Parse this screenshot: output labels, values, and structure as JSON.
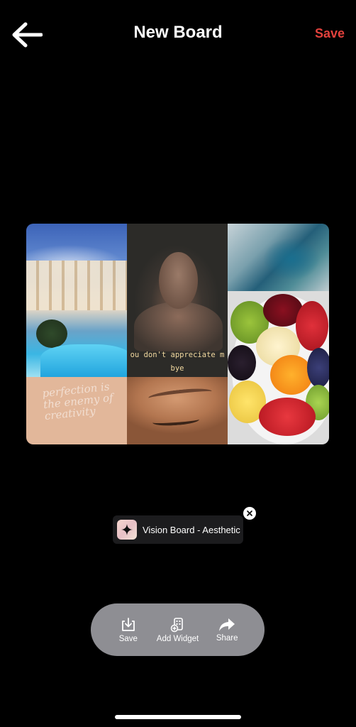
{
  "header": {
    "back_icon": "arrow-left-icon",
    "title": "New Board",
    "save_label": "Save"
  },
  "board": {
    "tiles": [
      {
        "name": "luxury-house-photo"
      },
      {
        "name": "woman-in-water-photo",
        "caption_line1": "ou don't appreciate m",
        "caption_line2": "bye"
      },
      {
        "name": "sea-cave-photo"
      },
      {
        "name": "fruit-platter-photo"
      },
      {
        "name": "handwritten-quote-photo",
        "script_text": "perfection is the enemy of creativity"
      },
      {
        "name": "closed-eye-photo"
      }
    ]
  },
  "widget_chip": {
    "label": "Vision Board - Aesthetic",
    "thumb_icon": "sparkle-icon",
    "close_icon": "close-icon"
  },
  "actions": [
    {
      "label": "Save",
      "icon": "download-icon"
    },
    {
      "label": "Add Widget",
      "icon": "add-widget-icon"
    },
    {
      "label": "Share",
      "icon": "share-arrow-icon"
    }
  ],
  "colors": {
    "background": "#000000",
    "accent": "#e2413c",
    "actionbar": "#8e8e93",
    "chip": "#1c1c1e"
  }
}
